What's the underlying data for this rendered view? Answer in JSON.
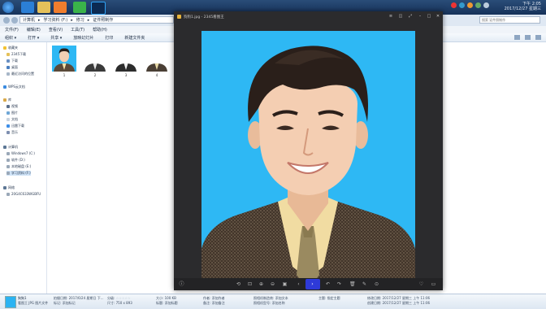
{
  "taskbar": {
    "clock_line1": "下午 2:05",
    "clock_line2": "2017/12/27 星期三",
    "colors": {
      "bar": "#1f3f68"
    }
  },
  "explorer": {
    "breadcrumb": [
      "计算机",
      "学习资料 (F:)",
      "修习",
      "证件照制作"
    ],
    "search_placeholder": "搜索 证件照制作",
    "menu": [
      "文件(F)",
      "编辑(E)",
      "查看(V)",
      "工具(T)",
      "帮助(H)"
    ],
    "toolbar": [
      "组织 ▾",
      "打开 ▾",
      "共享 ▾",
      "放映幻灯片",
      "打印",
      "新建文件夹"
    ],
    "nav": {
      "favorites_header": "收藏夹",
      "favorites": [
        "2345下载",
        "下载",
        "桌面",
        "最近访问的位置"
      ],
      "wps": "WPS云文档",
      "libraries_header": "库",
      "libraries": [
        "视频",
        "图片",
        "文档",
        "迅雷下载",
        "音乐"
      ],
      "computer_header": "计算机",
      "drives": [
        "Windows7 (C:)",
        "软件 (D:)",
        "本地磁盘 (E:)",
        "学习资料 (F:)"
      ],
      "network_header": "网络",
      "network": [
        "20G4C633WGBFU"
      ]
    },
    "files": [
      "1",
      "2",
      "3",
      "4"
    ]
  },
  "details": {
    "name": "狗狗1",
    "type": "看图王 JPG 图片文件",
    "taken_label": "拍摄日期:",
    "taken_value": "2017/6/24 星期日 下...",
    "tags_label": "标记:",
    "tags_value": "添加标记",
    "rating_label": "分级:",
    "dimensions_label": "尺寸:",
    "dimensions_value": "750 x 893",
    "size_label": "大小:",
    "size_value": "100 KB",
    "title_label": "标题:",
    "title_value": "添加标题",
    "author_label": "作者:",
    "author_value": "添加作者",
    "comment_label": "备注:",
    "comment_value": "添加备注",
    "camera_maker_label": "照相机制造商:",
    "camera_maker_value": "添加文本",
    "camera_model_label": "照相机型号:",
    "camera_model_value": "添加名称",
    "subject_label": "主题:",
    "subject_value": "指定主题",
    "modified_label": "修改日期:",
    "modified_value": "2017/12/27 星期三 上午 11:06",
    "created_label": "创建日期:",
    "created_value": "2017/12/27 星期三 上午 11:06"
  },
  "viewer": {
    "title": "狗狗1.jpg - 2345看图王",
    "background_color": "#2eb8f4"
  }
}
